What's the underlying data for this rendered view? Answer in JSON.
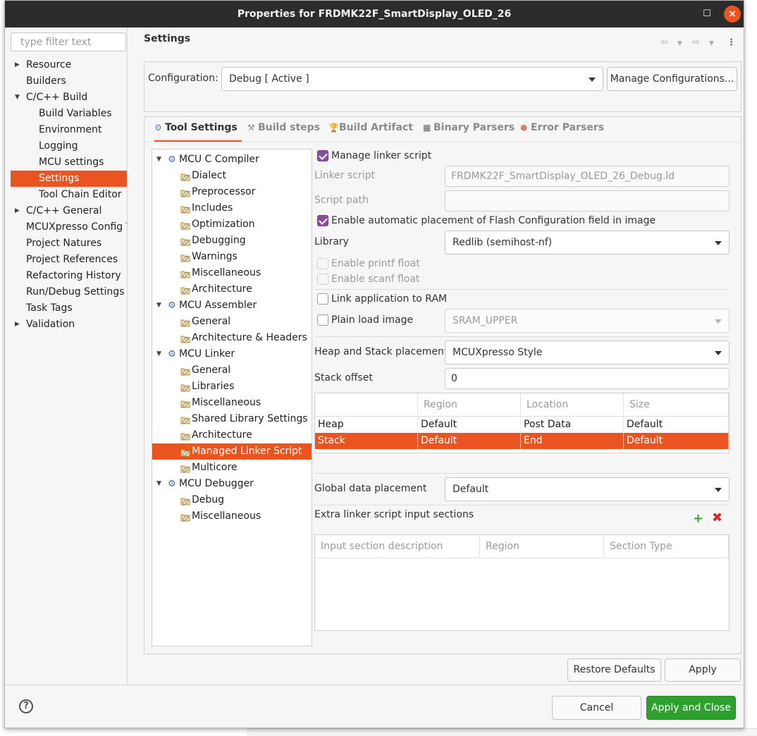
{
  "window": {
    "title": "Properties for FRDMK22F_SmartDisplay_OLED_26"
  },
  "filter": {
    "placeholder": "type filter text"
  },
  "nav": [
    {
      "label": "Resource",
      "expander": "right"
    },
    {
      "label": "Builders"
    },
    {
      "label": "C/C++ Build",
      "expander": "down"
    },
    {
      "label": "Build Variables"
    },
    {
      "label": "Environment"
    },
    {
      "label": "Logging"
    },
    {
      "label": "MCU settings"
    },
    {
      "label": "Settings",
      "selected": true
    },
    {
      "label": "Tool Chain Editor"
    },
    {
      "label": "C/C++ General",
      "expander": "right"
    },
    {
      "label": "MCUXpresso Config T"
    },
    {
      "label": "Project Natures"
    },
    {
      "label": "Project References"
    },
    {
      "label": "Refactoring History"
    },
    {
      "label": "Run/Debug Settings"
    },
    {
      "label": "Task Tags"
    },
    {
      "label": "Validation",
      "expander": "right"
    }
  ],
  "settings": {
    "title": "Settings"
  },
  "config": {
    "label": "Configuration:",
    "value": "Debug  [ Active ]",
    "manage_button": "Manage Configurations..."
  },
  "tabs": [
    {
      "label": "Tool Settings",
      "active": true,
      "icon": "tool-settings-icon"
    },
    {
      "label": "Build steps",
      "icon": "build-steps-icon"
    },
    {
      "label": "Build Artifact",
      "icon": "build-artifact-icon"
    },
    {
      "label": "Binary Parsers",
      "icon": "binary-parsers-icon"
    },
    {
      "label": "Error Parsers",
      "icon": "error-parsers-icon"
    }
  ],
  "tree": [
    {
      "label": "MCU C Compiler",
      "tool": true
    },
    {
      "label": "Dialect"
    },
    {
      "label": "Preprocessor"
    },
    {
      "label": "Includes"
    },
    {
      "label": "Optimization"
    },
    {
      "label": "Debugging"
    },
    {
      "label": "Warnings"
    },
    {
      "label": "Miscellaneous"
    },
    {
      "label": "Architecture"
    },
    {
      "label": "MCU Assembler",
      "tool": true
    },
    {
      "label": "General"
    },
    {
      "label": "Architecture & Headers"
    },
    {
      "label": "MCU Linker",
      "tool": true
    },
    {
      "label": "General"
    },
    {
      "label": "Libraries"
    },
    {
      "label": "Miscellaneous"
    },
    {
      "label": "Shared Library Settings"
    },
    {
      "label": "Architecture"
    },
    {
      "label": "Managed Linker Script",
      "selected": true
    },
    {
      "label": "Multicore"
    },
    {
      "label": "MCU Debugger",
      "tool": true
    },
    {
      "label": "Debug"
    },
    {
      "label": "Miscellaneous"
    }
  ],
  "linker": {
    "manage_linker_script": {
      "label": "Manage linker script",
      "checked": true
    },
    "linker_script_label": "Linker script",
    "linker_script_value": "FRDMK22F_SmartDisplay_OLED_26_Debug.ld",
    "script_path_label": "Script path",
    "script_path_value": "",
    "flash_config": {
      "label": "Enable automatic placement of Flash Configuration field in image",
      "checked": true
    },
    "library_label": "Library",
    "library_value": "Redlib (semihost-nf)",
    "printf_float": {
      "label": "Enable printf float",
      "checked": false,
      "disabled": true
    },
    "scanf_float": {
      "label": "Enable scanf float",
      "checked": false,
      "disabled": true
    },
    "link_to_ram": {
      "label": "Link application to RAM",
      "checked": false
    },
    "plain_load": {
      "label": "Plain load image",
      "checked": false
    },
    "plain_load_value": "SRAM_UPPER",
    "heap_stack_label": "Heap and Stack placement",
    "heap_stack_value": "MCUXpresso Style",
    "stack_offset_label": "Stack offset",
    "stack_offset_value": "0",
    "hs_table": {
      "columns": [
        "",
        "Region",
        "Location",
        "Size"
      ],
      "rows": [
        [
          "Heap",
          "Default",
          "Post Data",
          "Default"
        ],
        [
          "Stack",
          "Default",
          "End",
          "Default"
        ]
      ],
      "selected_row": 1
    },
    "global_data_label": "Global data placement",
    "global_data_value": "Default",
    "extra_sections_label": "Extra linker script input sections",
    "extra_table": {
      "columns": [
        "Input section description",
        "Region",
        "Section Type"
      ]
    }
  },
  "buttons": {
    "restore_defaults": "Restore Defaults",
    "apply": "Apply",
    "cancel": "Cancel",
    "apply_and_close": "Apply and Close"
  },
  "colors": {
    "accent": "#e95420",
    "primary_button": "#2da02d",
    "checkbox_checked": "#8a4d9d"
  }
}
